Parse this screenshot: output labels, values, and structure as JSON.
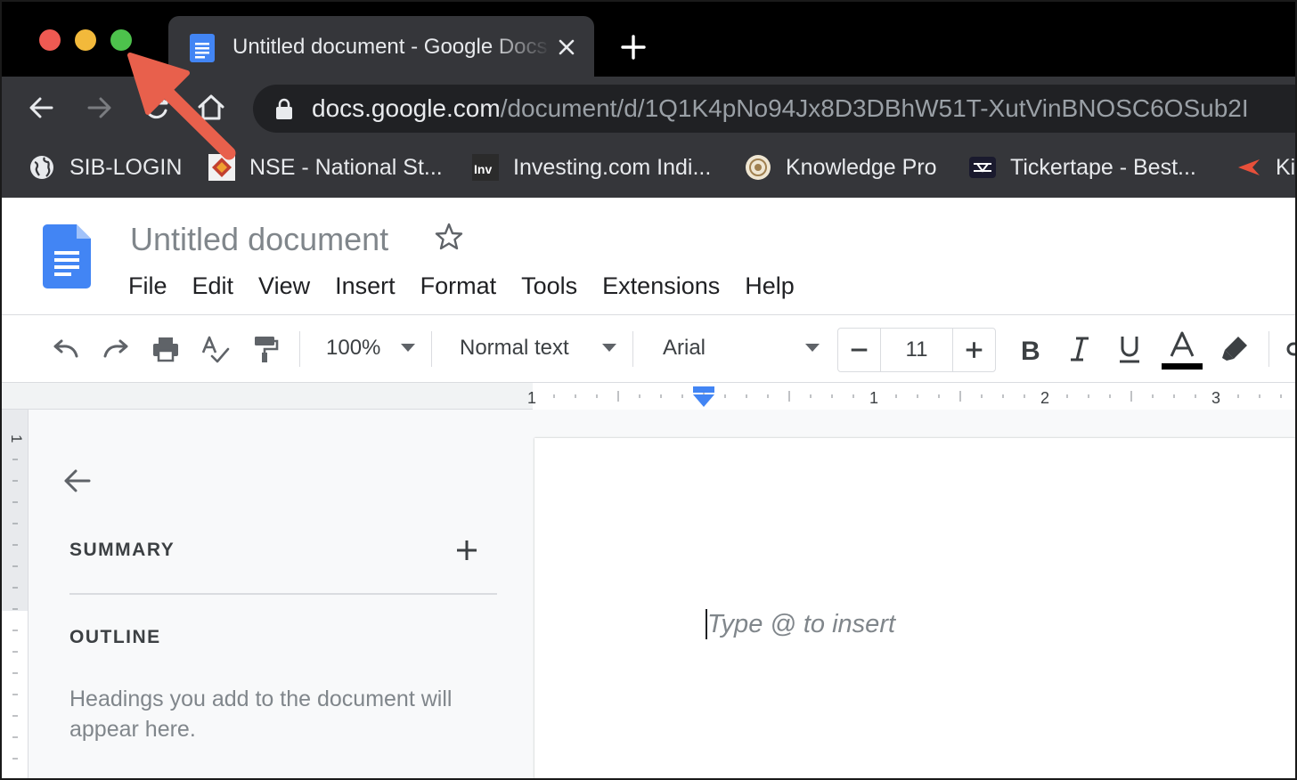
{
  "browser": {
    "tab": {
      "title": "Untitled document - Google Docs",
      "favicon": "google-docs-icon"
    },
    "url": {
      "host": "docs.google.com",
      "path": "/document/d/1Q1K4pNo94Jx8D3DBhW51T-XutVinBNOSC6OSub2I"
    },
    "bookmarks": [
      {
        "label": "SIB-LOGIN",
        "icon": "globe-icon"
      },
      {
        "label": "NSE - National St...",
        "icon": "nse-logo-icon"
      },
      {
        "label": "Investing.com Indi...",
        "icon": "investing-logo-icon"
      },
      {
        "label": "Knowledge Pro",
        "icon": "emblem-icon"
      },
      {
        "label": "Tickertape - Best...",
        "icon": "tickertape-logo-icon"
      },
      {
        "label": "Ki",
        "icon": "kite-logo-icon"
      }
    ]
  },
  "docs": {
    "title": "Untitled document",
    "menu": [
      "File",
      "Edit",
      "View",
      "Insert",
      "Format",
      "Tools",
      "Extensions",
      "Help"
    ],
    "toolbar": {
      "zoom": "100%",
      "style": "Normal text",
      "font": "Arial",
      "font_size": "11"
    },
    "ruler": {
      "marks": [
        "1",
        "1",
        "2",
        "3"
      ]
    },
    "vertical_ruler": {
      "mark": "1"
    },
    "outline_panel": {
      "summary_label": "SUMMARY",
      "outline_label": "OUTLINE",
      "hint": "Headings you add to the document will appear here."
    },
    "page": {
      "placeholder": "Type @ to insert"
    }
  },
  "colors": {
    "annotation_arrow": "#e8604c",
    "docs_blue": "#4285f4",
    "traffic_close": "#ee5a52",
    "traffic_minimize": "#f2b93b",
    "traffic_maximize": "#4dc24c"
  }
}
